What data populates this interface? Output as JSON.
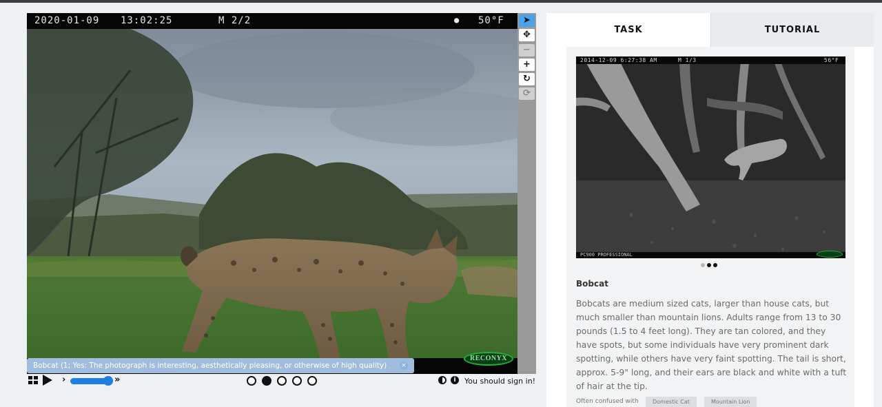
{
  "viewer": {
    "cam_date": "2020-01-09",
    "cam_time": "13:02:25",
    "cam_sequence": "M 2/2",
    "cam_moon": "●",
    "cam_temp": "50°F",
    "brand": "RECONYX",
    "caption": "Bobcat (1; Yes: The photograph is interesting, aesthetically pleasing, or otherwise of high quality)",
    "caption_close": "×"
  },
  "toolbar": {
    "tools": [
      {
        "name": "pointer-tool",
        "glyph": "➤",
        "state": "active"
      },
      {
        "name": "move-tool",
        "glyph": "✥",
        "state": "normal"
      },
      {
        "name": "zoom-out-tool",
        "glyph": "−",
        "state": "disabled"
      },
      {
        "name": "zoom-in-tool",
        "glyph": "+",
        "state": "normal"
      },
      {
        "name": "rotate-tool",
        "glyph": "↻",
        "state": "normal"
      },
      {
        "name": "reset-tool",
        "glyph": "⟳",
        "state": "disabled"
      }
    ]
  },
  "controls": {
    "frame_count": 5,
    "current_frame": 2,
    "speed_left": "›",
    "speed_right": "»",
    "info_glyph": "i",
    "signin": "You should sign in!"
  },
  "tabs": {
    "task": "TASK",
    "tutorial": "TUTORIAL"
  },
  "guide": {
    "ref_date": "2014-12-09 6:27:38 AM",
    "ref_seq": "M 1/3",
    "ref_temp": "56°F",
    "ref_model": "PC900 PROFESSIONAL",
    "image_count": 3,
    "image_current": 2,
    "title": "Bobcat",
    "description": "Bobcats are medium sized cats, larger than house cats, but much smaller than mountain lions. Adults range from 13 to 30 pounds (1.5 to 4 feet long). They are tan colored, and they have spots, but some individuals have very prominent dark spotting, while others have very faint spotting. The tail is short, approx. 5-9\" long, and their ears are black and white with a tuft of hair at the tip.",
    "confused_label": "Often confused with",
    "confused_with": [
      "Domestic Cat",
      "Mountain Lion"
    ]
  },
  "colors": {
    "accent": "#1f7fe0",
    "tool_active": "#4aa3e8",
    "caption_bg": "#afcdf0"
  }
}
